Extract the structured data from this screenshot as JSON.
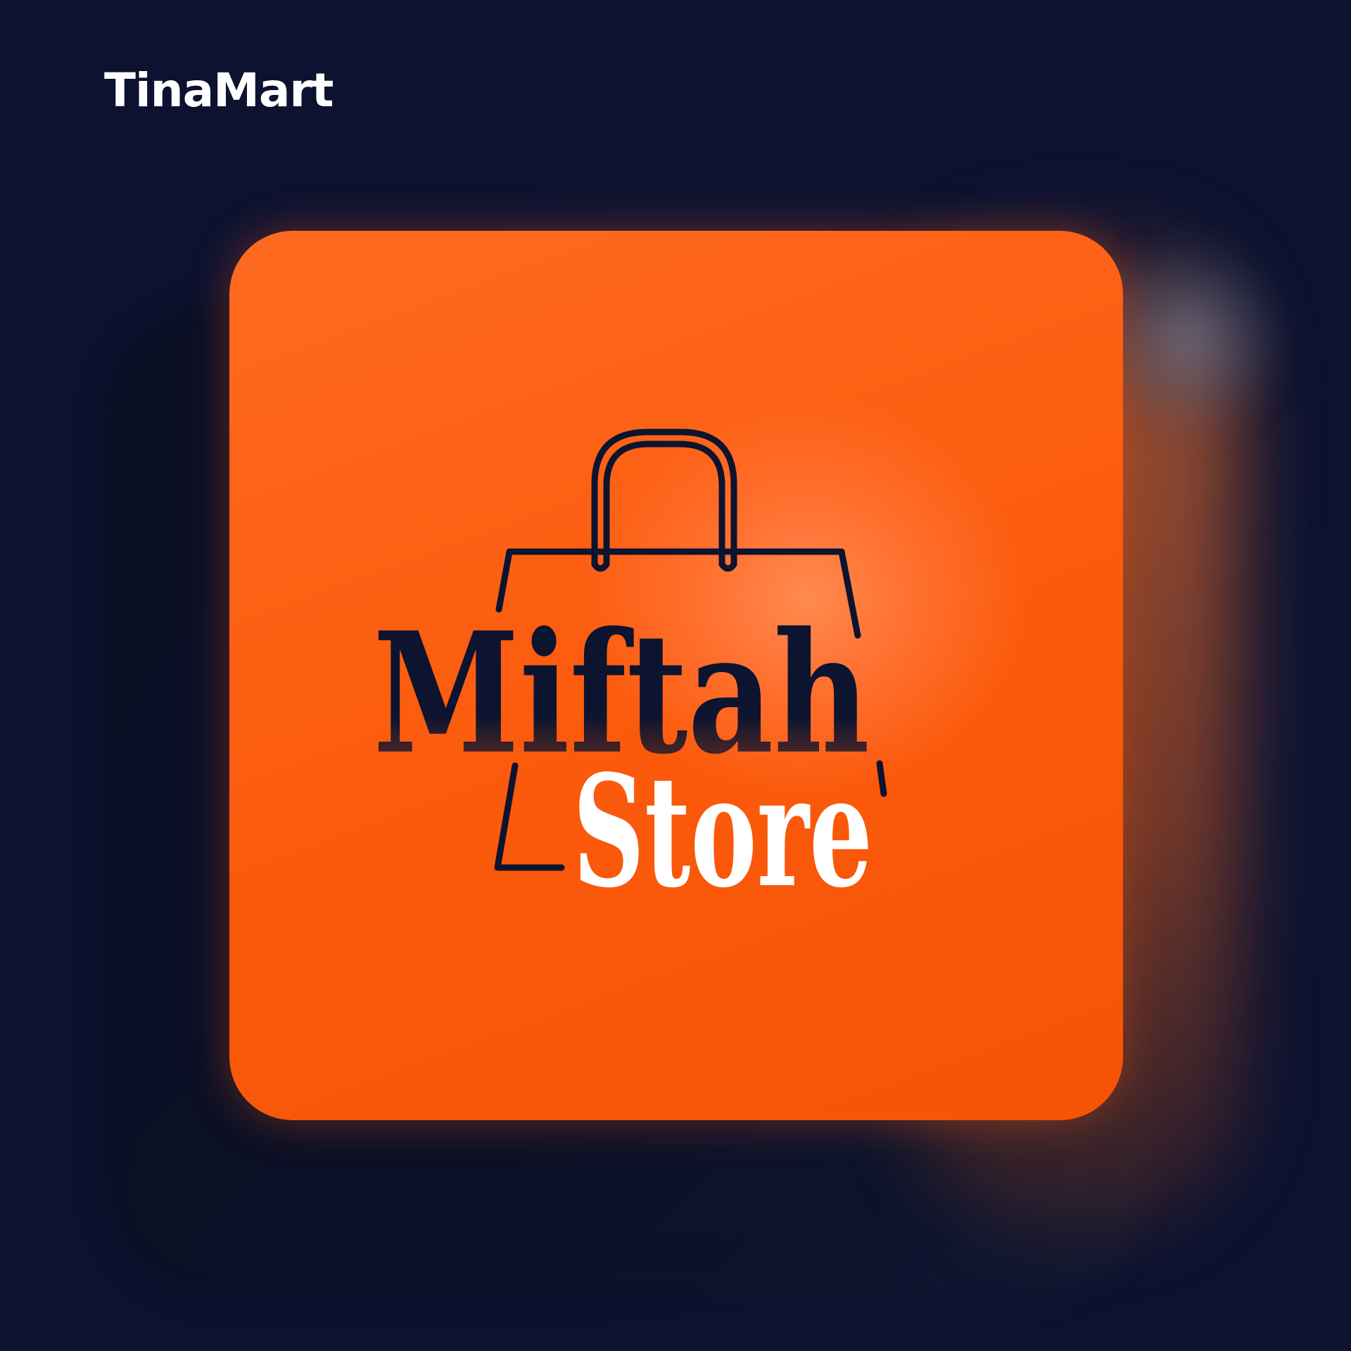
{
  "brand": {
    "name": "TinaMart"
  },
  "logo": {
    "line1": "Miftah",
    "line2": "Store",
    "icon": "shopping-bag-icon"
  },
  "colors": {
    "background": "#0e1532",
    "tile": "#fb5a0c",
    "ink": "#0d1430",
    "white": "#ffffff"
  }
}
